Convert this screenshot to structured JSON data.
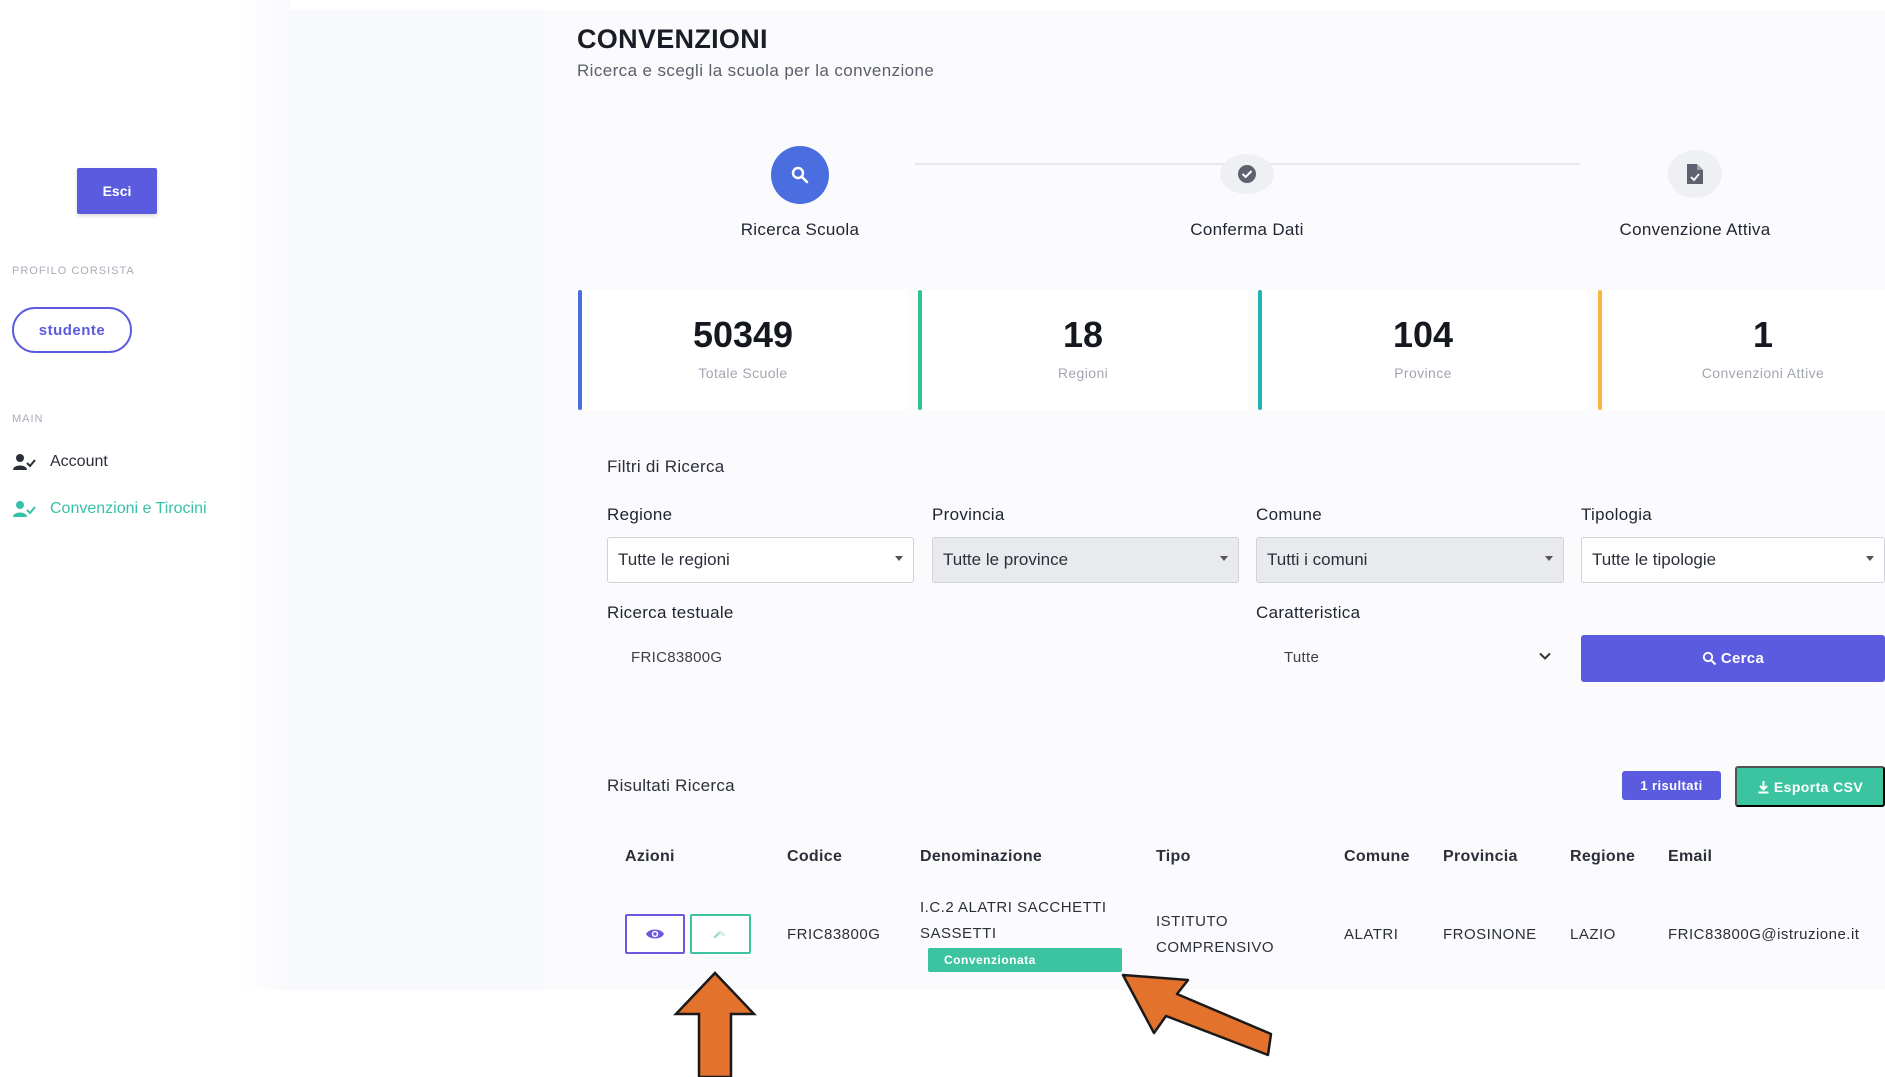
{
  "sidebar": {
    "logout_label": "Esci",
    "profile_section_label": "PROFILO CORSISTA",
    "profile_pill": "studente",
    "main_section_label": "MAIN",
    "nav": [
      {
        "label": "Account",
        "icon": "user-check-icon"
      },
      {
        "label": "Convenzioni e Tirocini",
        "icon": "user-check-icon",
        "active": true
      }
    ]
  },
  "header": {
    "title": "CONVENZIONI",
    "subtitle": "Ricerca e scegli la scuola per la convenzione"
  },
  "stepper": {
    "steps": [
      {
        "label": "Ricerca Scuola",
        "icon": "search-icon",
        "active": true
      },
      {
        "label": "Conferma Dati",
        "icon": "check-circle-icon",
        "active": false
      },
      {
        "label": "Convenzione Attiva",
        "icon": "file-check-icon",
        "active": false
      }
    ]
  },
  "stats": [
    {
      "value": "50349",
      "label": "Totale Scuole",
      "color": "#4a6ee0"
    },
    {
      "value": "18",
      "label": "Regioni",
      "color": "#2fc48d"
    },
    {
      "value": "104",
      "label": "Province",
      "color": "#23b3b0"
    },
    {
      "value": "1",
      "label": "Convenzioni Attive",
      "color": "#f5b83d"
    }
  ],
  "filters": {
    "title": "Filtri di Ricerca",
    "regione": {
      "label": "Regione",
      "value": "Tutte le regioni"
    },
    "provincia": {
      "label": "Provincia",
      "value": "Tutte le province"
    },
    "comune": {
      "label": "Comune",
      "value": "Tutti i comuni"
    },
    "tipologia": {
      "label": "Tipologia",
      "value": "Tutte le tipologie"
    },
    "ricerca": {
      "label": "Ricerca testuale",
      "value": "FRIC83800G"
    },
    "caratteristica": {
      "label": "Caratteristica",
      "value": "Tutte"
    },
    "search_button": "Cerca"
  },
  "results": {
    "title": "Risultati Ricerca",
    "count_button": "1 risultati",
    "export_button": "Esporta CSV",
    "columns": [
      "Azioni",
      "Codice",
      "Denominazione",
      "Tipo",
      "Comune",
      "Provincia",
      "Regione",
      "Email"
    ],
    "rows": [
      {
        "codice": "FRIC83800G",
        "denominazione_1": "I.C.2 ALATRI SACCHETTI",
        "denominazione_2": "SASSETTI",
        "badge": "Convenzionata",
        "tipo_1": "ISTITUTO",
        "tipo_2": "COMPRENSIVO",
        "comune": "ALATRI",
        "provincia": "FROSINONE",
        "regione": "LAZIO",
        "email": "FRIC83800G@istruzione.it"
      }
    ]
  },
  "colors": {
    "primary": "#5b5be0",
    "step_active": "#4a6ee0",
    "success": "#3cc4a0",
    "annotation_arrow": "#e2722c"
  }
}
